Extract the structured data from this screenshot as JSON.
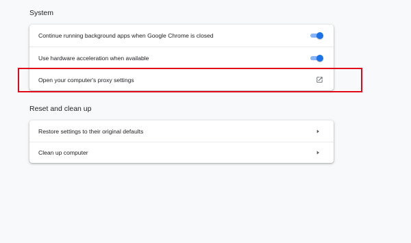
{
  "sections": {
    "system": {
      "title": "System",
      "rows": [
        {
          "label": "Continue running background apps when Google Chrome is closed",
          "control": "toggle",
          "enabled": true
        },
        {
          "label": "Use hardware acceleration when available",
          "control": "toggle",
          "enabled": true
        },
        {
          "label": "Open your computer's proxy settings",
          "control": "open-in-new-icon"
        }
      ]
    },
    "reset": {
      "title": "Reset and clean up",
      "rows": [
        {
          "label": "Restore settings to their original defaults",
          "control": "chevron-right-icon"
        },
        {
          "label": "Clean up computer",
          "control": "chevron-right-icon"
        }
      ]
    }
  },
  "colors": {
    "toggle_on": "#1a73e8",
    "toggle_track": "#8ab4f8",
    "highlight_box": "#e0091a",
    "background": "#f8f9fa"
  }
}
